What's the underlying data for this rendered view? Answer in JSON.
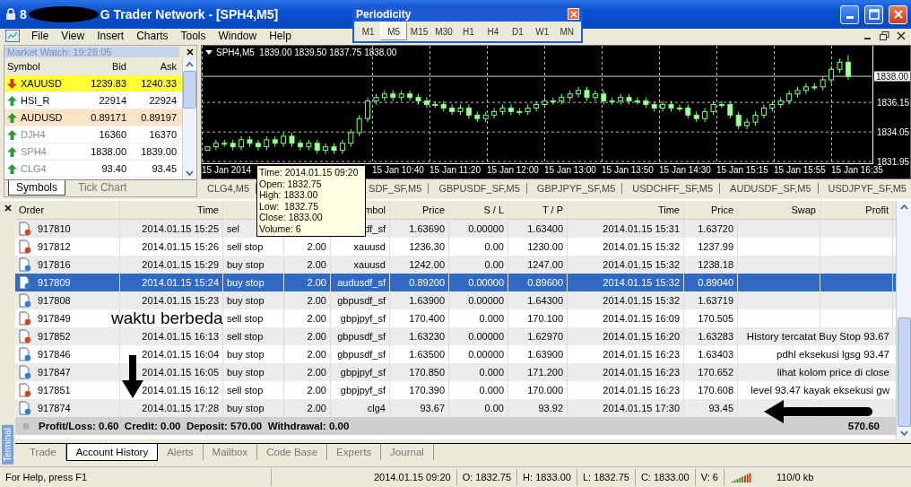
{
  "window": {
    "title_start": "8",
    "title": "G Trader Network - [SPH4,M5]"
  },
  "menu": [
    "File",
    "View",
    "Insert",
    "Charts",
    "Tools",
    "Window",
    "Help"
  ],
  "periodicity": {
    "title": "Periodicity",
    "periods": [
      {
        "label": "M1",
        "selected": false
      },
      {
        "label": "M5",
        "selected": true
      },
      {
        "label": "M15",
        "selected": false
      },
      {
        "label": "M30",
        "selected": false
      },
      {
        "label": "H1",
        "selected": false
      },
      {
        "label": "H4",
        "selected": false
      },
      {
        "label": "D1",
        "selected": false
      },
      {
        "label": "W1",
        "selected": false
      },
      {
        "label": "MN",
        "selected": false
      }
    ]
  },
  "market_watch": {
    "title": "Market Watch: 19:28:05",
    "columns": [
      "Symbol",
      "Bid",
      "Ask"
    ],
    "rows": [
      {
        "symbol": "XAUUSD",
        "bid": "1239.83",
        "ask": "1240.33",
        "kind": "down",
        "color": "#ffff33",
        "greyed": false
      },
      {
        "symbol": "HSI_R",
        "bid": "22914",
        "ask": "22924",
        "kind": "up",
        "color": "#ffffff",
        "greyed": false
      },
      {
        "symbol": "AUDUSD",
        "bid": "0.89171",
        "ask": "0.89197",
        "kind": "up",
        "color": "#fbe3c8",
        "greyed": false
      },
      {
        "symbol": "DJH4",
        "bid": "16360",
        "ask": "16370",
        "kind": "up",
        "color": "#ffffff",
        "greyed": true
      },
      {
        "symbol": "SPH4",
        "bid": "1838.00",
        "ask": "1839.00",
        "kind": "up",
        "color": "#ffffff",
        "greyed": true
      },
      {
        "symbol": "CLG4",
        "bid": "93.40",
        "ask": "93.45",
        "kind": "up",
        "color": "#ffffff",
        "greyed": true
      }
    ],
    "tabs": [
      {
        "label": "Symbols",
        "selected": true
      },
      {
        "label": "Tick Chart",
        "selected": false
      }
    ]
  },
  "chart": {
    "header": "SPH4,M5  1839.00 1839.50 1837.75 1838.00",
    "tooltip": [
      "Time: 2014.01.15 09:20",
      "Open: 1832.75",
      "High: 1833.00",
      "Low:  1832.75",
      "Close: 1833.00",
      "Volume: 6"
    ],
    "time_labels": [
      "15 Jan 2014",
      "15 Jan 10:40",
      "15 Jan 11:20",
      "15 Jan 12:00",
      "15 Jan 13:00",
      "15 Jan 13:50",
      "15 Jan 14:30",
      "15 Jan 15:15",
      "15 Jan 15:55",
      "15 Jan 16:35"
    ],
    "chart_data": {
      "type": "candlestick",
      "ylim": [
        1831.77,
        1840.17
      ],
      "yticks": [
        1831.95,
        1834.05,
        1836.15
      ],
      "grid": true,
      "ref_lines": [
        {
          "axis": "y",
          "value": 1838.0,
          "label": "1838.00"
        }
      ],
      "ohlc": [
        [
          1832.75,
          1833.0,
          1832.75,
          1833.0
        ],
        [
          1833.0,
          1833.5,
          1832.75,
          1833.25
        ],
        [
          1833.25,
          1833.5,
          1833.0,
          1833.25
        ],
        [
          1833.25,
          1833.5,
          1832.75,
          1833.0
        ],
        [
          1833.0,
          1833.75,
          1832.75,
          1833.5
        ],
        [
          1833.5,
          1833.75,
          1833.0,
          1833.25
        ],
        [
          1833.25,
          1833.5,
          1832.75,
          1833.0
        ],
        [
          1833.0,
          1833.75,
          1832.75,
          1833.5
        ],
        [
          1833.5,
          1833.75,
          1833.0,
          1833.25
        ],
        [
          1833.25,
          1834.0,
          1833.0,
          1833.75
        ],
        [
          1833.75,
          1834.0,
          1833.0,
          1833.25
        ],
        [
          1833.25,
          1833.5,
          1832.75,
          1833.0
        ],
        [
          1833.0,
          1833.5,
          1832.75,
          1833.25
        ],
        [
          1833.25,
          1833.5,
          1832.5,
          1832.75
        ],
        [
          1832.75,
          1833.25,
          1832.5,
          1833.0
        ],
        [
          1833.0,
          1833.25,
          1832.5,
          1832.75
        ],
        [
          1832.75,
          1833.5,
          1832.5,
          1833.25
        ],
        [
          1833.25,
          1834.25,
          1833.0,
          1834.0
        ],
        [
          1834.0,
          1835.25,
          1833.75,
          1835.0
        ],
        [
          1835.0,
          1836.5,
          1834.75,
          1836.25
        ],
        [
          1836.25,
          1836.75,
          1836.0,
          1836.5
        ],
        [
          1836.5,
          1837.0,
          1836.25,
          1836.75
        ],
        [
          1836.75,
          1837.0,
          1836.25,
          1836.5
        ],
        [
          1836.5,
          1837.0,
          1836.25,
          1836.75
        ],
        [
          1836.75,
          1837.0,
          1836.25,
          1836.5
        ],
        [
          1836.5,
          1836.75,
          1836.0,
          1836.25
        ],
        [
          1836.25,
          1836.5,
          1835.75,
          1836.0
        ],
        [
          1836.0,
          1836.25,
          1835.75,
          1836.0
        ],
        [
          1836.0,
          1836.25,
          1835.5,
          1835.75
        ],
        [
          1835.75,
          1836.0,
          1835.25,
          1835.5
        ],
        [
          1835.5,
          1836.0,
          1835.25,
          1835.75
        ],
        [
          1835.75,
          1836.0,
          1835.0,
          1835.25
        ],
        [
          1835.25,
          1835.5,
          1834.75,
          1835.0
        ],
        [
          1835.0,
          1835.5,
          1834.75,
          1835.25
        ],
        [
          1835.25,
          1835.75,
          1835.0,
          1835.5
        ],
        [
          1835.5,
          1836.0,
          1835.25,
          1835.75
        ],
        [
          1835.75,
          1836.0,
          1835.25,
          1835.5
        ],
        [
          1835.5,
          1835.75,
          1835.25,
          1835.5
        ],
        [
          1835.5,
          1836.0,
          1835.25,
          1835.75
        ],
        [
          1835.75,
          1836.25,
          1835.5,
          1836.0
        ],
        [
          1836.0,
          1836.5,
          1835.75,
          1836.25
        ],
        [
          1836.25,
          1836.5,
          1836.0,
          1836.25
        ],
        [
          1836.25,
          1836.75,
          1836.0,
          1836.5
        ],
        [
          1836.5,
          1837.0,
          1836.25,
          1836.75
        ],
        [
          1836.75,
          1837.25,
          1836.5,
          1837.0
        ],
        [
          1837.0,
          1837.25,
          1836.25,
          1836.5
        ],
        [
          1836.5,
          1837.0,
          1836.25,
          1836.75
        ],
        [
          1836.75,
          1837.0,
          1836.0,
          1836.25
        ],
        [
          1836.25,
          1836.5,
          1836.0,
          1836.25
        ],
        [
          1836.25,
          1836.75,
          1836.0,
          1836.5
        ],
        [
          1836.5,
          1836.75,
          1836.0,
          1836.25
        ],
        [
          1836.25,
          1836.5,
          1836.0,
          1836.25
        ],
        [
          1836.25,
          1836.5,
          1835.75,
          1836.0
        ],
        [
          1836.0,
          1836.25,
          1835.5,
          1835.75
        ],
        [
          1835.75,
          1836.25,
          1835.5,
          1836.0
        ],
        [
          1836.0,
          1836.25,
          1835.5,
          1835.75
        ],
        [
          1835.75,
          1836.0,
          1835.5,
          1835.75
        ],
        [
          1835.75,
          1836.0,
          1835.0,
          1835.25
        ],
        [
          1835.25,
          1835.5,
          1834.75,
          1835.0
        ],
        [
          1835.0,
          1835.75,
          1834.75,
          1835.5
        ],
        [
          1835.5,
          1836.25,
          1835.25,
          1836.0
        ],
        [
          1836.0,
          1836.25,
          1835.75,
          1836.0
        ],
        [
          1836.0,
          1836.25,
          1835.0,
          1835.25
        ],
        [
          1835.25,
          1835.5,
          1834.25,
          1834.5
        ],
        [
          1834.5,
          1835.0,
          1834.25,
          1834.75
        ],
        [
          1834.75,
          1835.5,
          1834.5,
          1835.25
        ],
        [
          1835.25,
          1836.0,
          1835.0,
          1835.75
        ],
        [
          1835.75,
          1836.25,
          1835.5,
          1836.0
        ],
        [
          1836.0,
          1836.5,
          1835.75,
          1836.25
        ],
        [
          1836.25,
          1837.0,
          1836.0,
          1836.75
        ],
        [
          1836.75,
          1837.25,
          1836.5,
          1837.0
        ],
        [
          1837.0,
          1837.5,
          1836.75,
          1837.25
        ],
        [
          1837.25,
          1837.5,
          1837.0,
          1837.25
        ],
        [
          1837.25,
          1838.0,
          1837.0,
          1837.75
        ],
        [
          1837.75,
          1838.75,
          1837.5,
          1838.5
        ],
        [
          1838.5,
          1839.25,
          1838.25,
          1839.0
        ],
        [
          1839.0,
          1839.5,
          1837.75,
          1838.0
        ]
      ]
    }
  },
  "chart_tabs": [
    "CLG4,M5",
    "SDF_SF,M5",
    "GBPUSDF_SF,M5",
    "GBPJPYF_SF,M5",
    "USDCHFF_SF,M5",
    "AUDUSDF_SF,M5",
    "USDJPYF_SF,M5"
  ],
  "history": {
    "columns": [
      {
        "label": "Order"
      },
      {
        "label": "Time"
      },
      {},
      {},
      {
        "label": "mbol"
      },
      {
        "label": "Price"
      },
      {
        "label": "S / L"
      },
      {
        "label": "T / P"
      },
      {
        "label": "Time"
      },
      {
        "label": "Price"
      },
      {
        "label": "Swap"
      },
      {
        "label": "Profit"
      }
    ],
    "rows": [
      {
        "kind": "sell",
        "selected": false,
        "cells": [
          "917810",
          "2014.01.15 15:25",
          "sel",
          null,
          "df_sf",
          "1.63690",
          "0.00000",
          "1.63400",
          "2014.01.15 15:31",
          "1.63720"
        ]
      },
      {
        "kind": "sell",
        "selected": false,
        "cells": [
          "917812",
          "2014.01.15 15:26",
          "sell stop",
          "2.00",
          "xauusd",
          "1236.30",
          "0.00",
          "1230.00",
          "2014.01.15 15:32",
          "1237.99"
        ]
      },
      {
        "kind": "buy",
        "selected": false,
        "cells": [
          "917816",
          "2014.01.15 15:29",
          "buy stop",
          "2.00",
          "xauusd",
          "1242.00",
          "0.00",
          "1247.00",
          "2014.01.15 15:32",
          "1238.18"
        ]
      },
      {
        "kind": "buy",
        "selected": true,
        "cells": [
          "917809",
          "2014.01.15 15:24",
          "buy stop",
          "2.00",
          "audusdf_sf",
          "0.89200",
          "0.00000",
          "0.89600",
          "2014.01.15 15:32",
          "0.89040"
        ]
      },
      {
        "kind": "buy",
        "selected": false,
        "cells": [
          "917808",
          "2014.01.15 15:23",
          "buy stop",
          "2.00",
          "gbpusdf_sf",
          "1.63900",
          "0.00000",
          "1.64300",
          "2014.01.15 15:32",
          "1.63719"
        ]
      },
      {
        "kind": "sell",
        "selected": false,
        "cells": [
          "917849",
          null,
          "sell stop",
          "2.00",
          "gbpjpyf_sf",
          "170.400",
          "0.000",
          "170.100",
          "2014.01.15 16:09",
          "170.505"
        ]
      },
      {
        "kind": "sell",
        "selected": false,
        "cells": [
          "917852",
          "2014.01.15 16:13",
          "sell stop",
          "2.00",
          "gbpusdf_sf",
          "1.63230",
          "0.00000",
          "1.62970",
          "2014.01.15 16:20",
          "1.63283"
        ]
      },
      {
        "kind": "buy",
        "selected": false,
        "cells": [
          "917846",
          "2014.01.15 16:04",
          "buy stop",
          "2.00",
          "gbpusdf_sf",
          "1.63500",
          "0.00000",
          "1.63900",
          "2014.01.15 16:23",
          "1.63403"
        ]
      },
      {
        "kind": "buy",
        "selected": false,
        "cells": [
          "917847",
          "2014.01.15 16:05",
          "buy stop",
          "2.00",
          "gbpjpyf_sf",
          "170.850",
          "0.000",
          "171.200",
          "2014.01.15 16:23",
          "170.652"
        ]
      },
      {
        "kind": "sell",
        "selected": false,
        "cells": [
          "917851",
          "2014.01.15 16:12",
          "sell stop",
          "2.00",
          "gbpjpyf_sf",
          "170.390",
          "0.000",
          "170.000",
          "2014.01.15 16:23",
          "170.608"
        ]
      },
      {
        "kind": "buy",
        "selected": false,
        "cells": [
          "917874",
          "2014.01.15 17:28",
          "buy stop",
          "2.00",
          "clg4",
          "93.67",
          "0.00",
          "93.92",
          "2014.01.15 17:30",
          "93.45"
        ]
      }
    ],
    "summary": "Profit/Loss: 0.60  Credit: 0.00  Deposit: 570.00  Withdrawal: 0.00",
    "total": "570.60"
  },
  "terminal": {
    "label": "Terminal",
    "tabs": [
      {
        "label": "Trade",
        "selected": false
      },
      {
        "label": "Account History",
        "selected": true
      },
      {
        "label": "Alerts",
        "selected": false
      },
      {
        "label": "Mailbox",
        "selected": false
      },
      {
        "label": "Code Base",
        "selected": false
      },
      {
        "label": "Experts",
        "selected": false
      },
      {
        "label": "Journal",
        "selected": false
      }
    ]
  },
  "status_bar": {
    "help": "For Help, press F1",
    "fields": [
      "2014.01.15 09:20",
      "O: 1832.75",
      "H: 1833.00",
      "L: 1832.75",
      "C: 1833.00",
      "V: 6"
    ],
    "traffic": "110/0 kb"
  },
  "annotations": [
    {
      "kind": "label",
      "text": "waktu berbeda"
    },
    {
      "kind": "note",
      "lines": [
        "History tercatat Buy Stop 93.67",
        "pdhl eksekusi lgsg 93.47",
        "lihat kolom price di close",
        "level 93.47 kayak eksekusi gw"
      ]
    },
    {
      "kind": "arrow-down"
    },
    {
      "kind": "arrow-left"
    }
  ]
}
